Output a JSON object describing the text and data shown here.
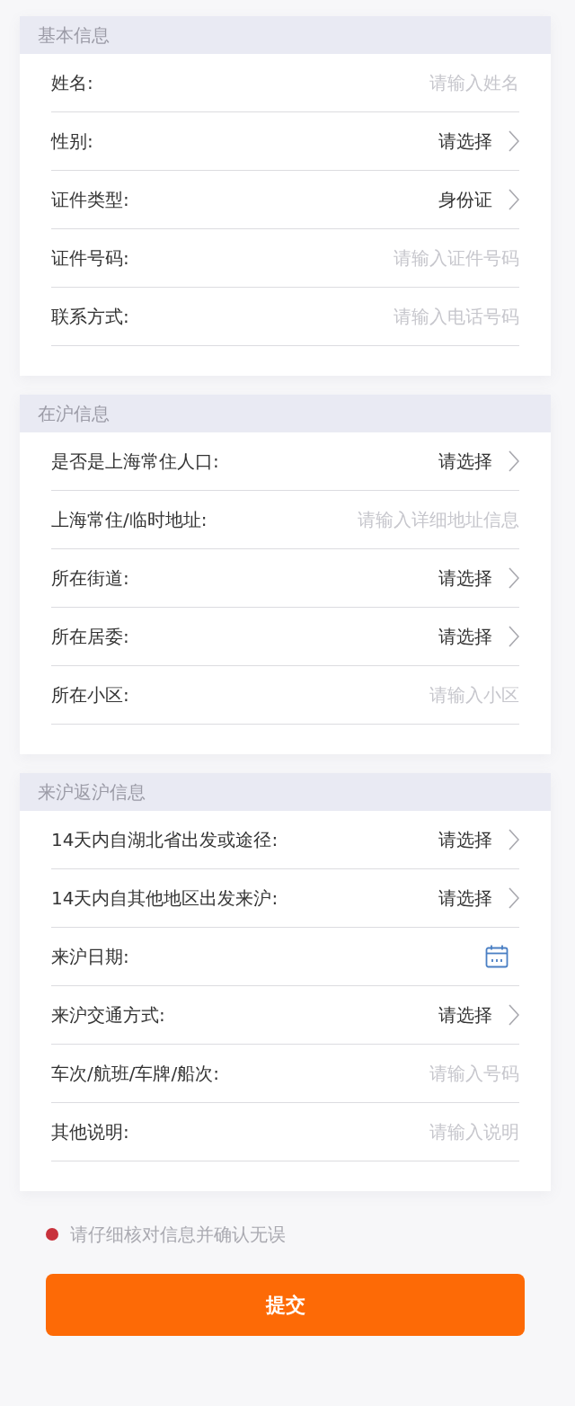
{
  "sections": [
    {
      "title": "基本信息",
      "fields": [
        {
          "kind": "text",
          "label": "姓名:",
          "placeholder": "请输入姓名"
        },
        {
          "kind": "select",
          "label": "性别:",
          "value": "请选择"
        },
        {
          "kind": "select",
          "label": "证件类型:",
          "value": "身份证"
        },
        {
          "kind": "text",
          "label": "证件号码:",
          "placeholder": "请输入证件号码"
        },
        {
          "kind": "text",
          "label": "联系方式:",
          "placeholder": "请输入电话号码"
        }
      ]
    },
    {
      "title": "在沪信息",
      "fields": [
        {
          "kind": "select",
          "label": "是否是上海常住人口:",
          "value": "请选择"
        },
        {
          "kind": "text",
          "label": "上海常住/临时地址:",
          "placeholder": "请输入详细地址信息"
        },
        {
          "kind": "select",
          "label": "所在街道:",
          "value": "请选择"
        },
        {
          "kind": "select",
          "label": "所在居委:",
          "value": "请选择"
        },
        {
          "kind": "text",
          "label": "所在小区:",
          "placeholder": "请输入小区"
        }
      ]
    },
    {
      "title": "来沪返沪信息",
      "fields": [
        {
          "kind": "select",
          "label": "14天内自湖北省出发或途径:",
          "value": "请选择"
        },
        {
          "kind": "select",
          "label": "14天内自其他地区出发来沪:",
          "value": "请选择"
        },
        {
          "kind": "date",
          "label": "来沪日期:"
        },
        {
          "kind": "select",
          "label": "来沪交通方式:",
          "value": "请选择"
        },
        {
          "kind": "text",
          "label": "车次/航班/车牌/船次:",
          "placeholder": "请输入号码"
        },
        {
          "kind": "text",
          "label": "其他说明:",
          "placeholder": "请输入说明"
        }
      ]
    }
  ],
  "notice": {
    "text": "请仔细核对信息并确认无误",
    "color": "#c8323c"
  },
  "submit_button": {
    "label": "提交"
  }
}
